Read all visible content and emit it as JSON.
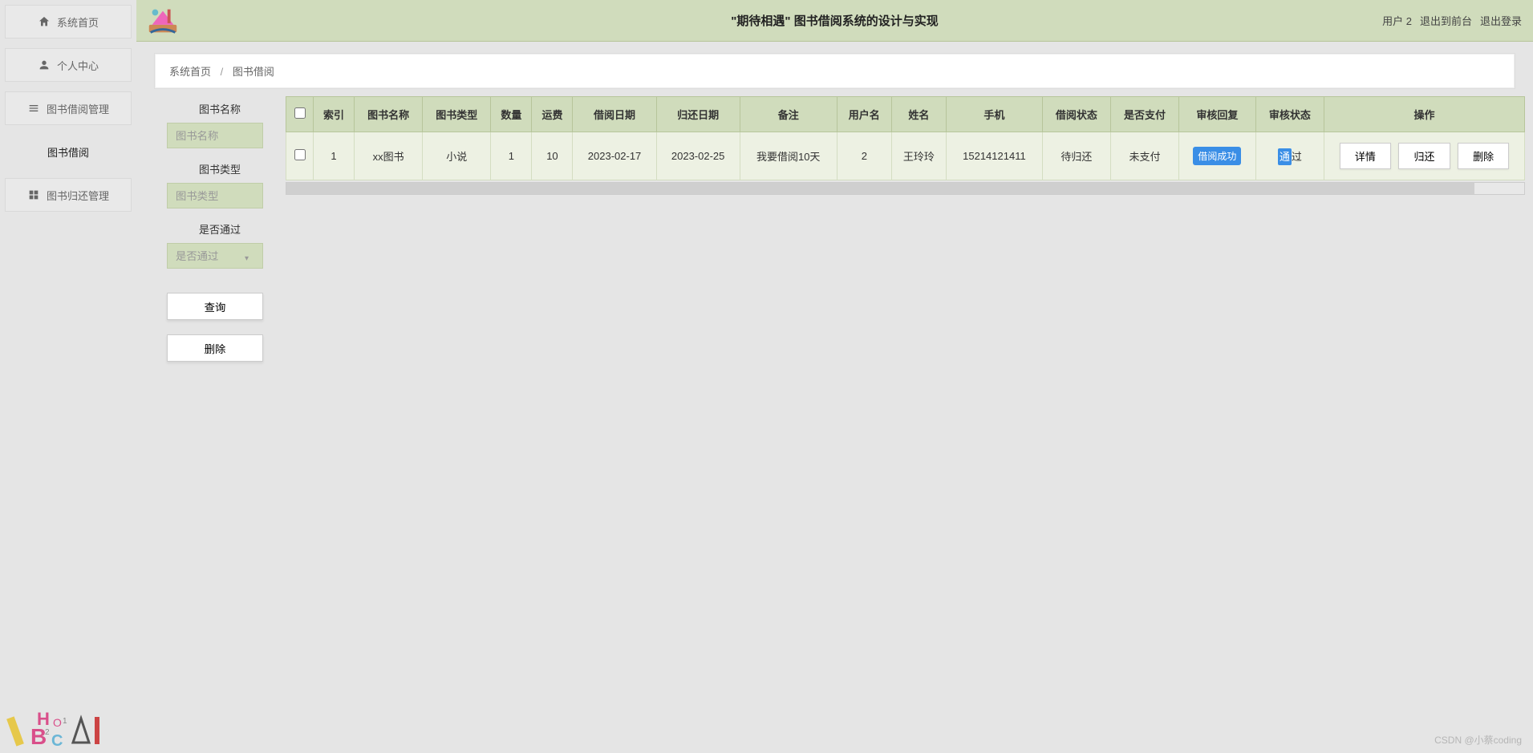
{
  "header": {
    "title": "\"期待相遇\" 图书借阅系统的设计与实现",
    "user_label": "用户 2",
    "link_front": "退出到前台",
    "link_logout": "退出登录"
  },
  "sidebar": {
    "items": [
      {
        "label": "系统首页",
        "icon": "home"
      },
      {
        "label": "个人中心",
        "icon": "person"
      },
      {
        "label": "图书借阅管理",
        "icon": "list"
      },
      {
        "label": "图书借阅",
        "sub": true,
        "active": true
      },
      {
        "label": "图书归还管理",
        "icon": "grid"
      }
    ]
  },
  "breadcrumb": {
    "root": "系统首页",
    "sep": "/",
    "leaf": "图书借阅"
  },
  "filters": {
    "book_name_label": "图书名称",
    "book_name_ph": "图书名称",
    "book_type_label": "图书类型",
    "book_type_ph": "图书类型",
    "pass_label": "是否通过",
    "pass_ph": "是否通过",
    "btn_query": "查询",
    "btn_delete": "删除"
  },
  "table": {
    "headers": [
      "索引",
      "图书名称",
      "图书类型",
      "数量",
      "运费",
      "借阅日期",
      "归还日期",
      "备注",
      "用户名",
      "姓名",
      "手机",
      "借阅状态",
      "是否支付",
      "审核回复",
      "审核状态",
      "操作"
    ],
    "row": {
      "index": "1",
      "book_name": "xx图书",
      "book_type": "小说",
      "qty": "1",
      "fee": "10",
      "borrow_date": "2023-02-17",
      "return_date": "2023-02-25",
      "remark": "我要借阅10天",
      "username": "2",
      "realname": "王玲玲",
      "phone": "15214121411",
      "borrow_status": "待归还",
      "paid": "未支付",
      "reply": "借阅成功",
      "audit_hl": "通",
      "audit_rest": "过"
    },
    "actions": {
      "detail": "详情",
      "return": "归还",
      "delete": "删除"
    }
  },
  "watermark": "CSDN @小蔡coding"
}
